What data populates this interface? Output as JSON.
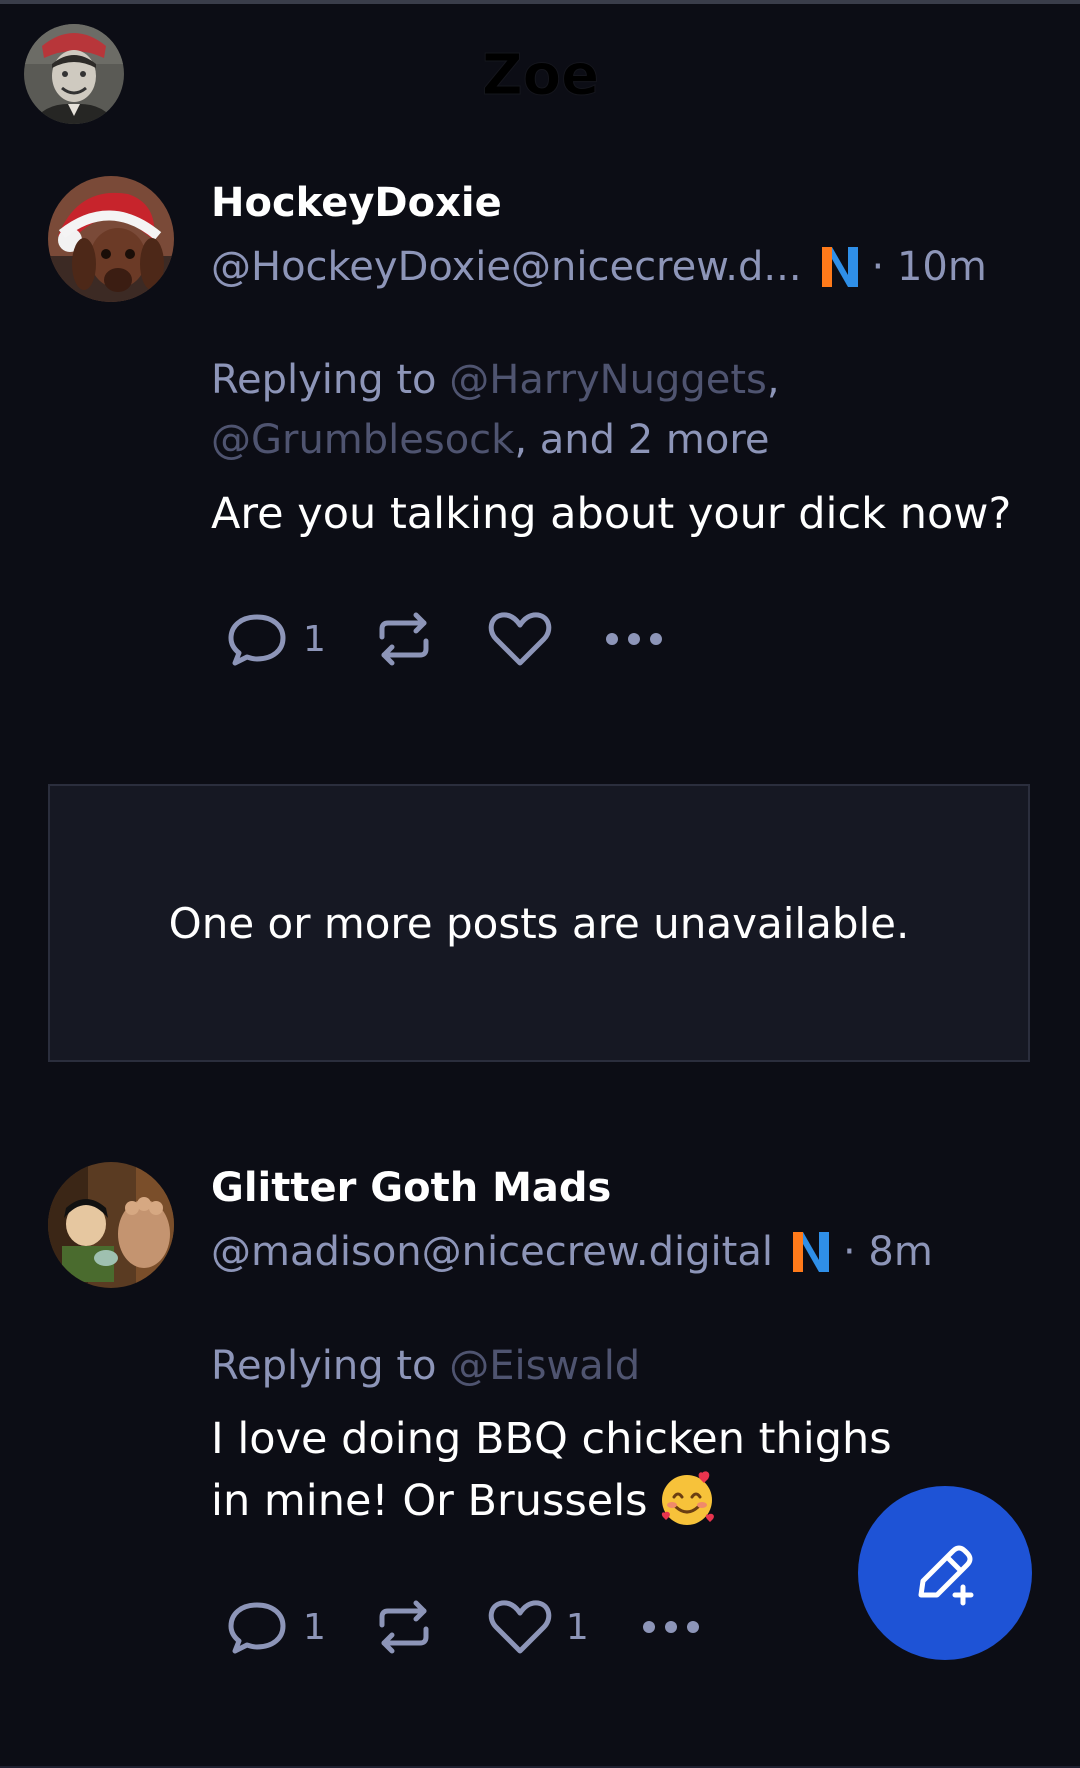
{
  "app": {
    "logo_text": "Zoe"
  },
  "colors": {
    "background": "#0c0d15",
    "muted_text": "#8d95b8",
    "mention_text": "#4f5470",
    "fab": "#1e53d6"
  },
  "posts": [
    {
      "display_name": "HockeyDoxie",
      "handle": "@HockeyDoxie@nicecrew.d...",
      "time": "· 10m",
      "reply_prefix": "Replying to ",
      "mention_1": "@HarryNuggets",
      "sep_1": ",",
      "mention_2": "@Grumblesock",
      "reply_suffix": ", and 2 more",
      "content": "Are you talking about your dick now?",
      "reply_count": "1",
      "repost_count": "",
      "like_count": ""
    },
    {
      "display_name": "Glitter Goth Mads",
      "handle": "@madison@nicecrew.digital",
      "time": "· 8m",
      "reply_prefix": "Replying to ",
      "mention_1": "@Eiswald",
      "content": "I love doing BBQ chicken thighs in mine! Or Brussels",
      "reply_count": "1",
      "repost_count": "",
      "like_count": "1"
    }
  ],
  "unavailable": {
    "text": "One or more posts are unavailable."
  },
  "icons": {
    "header_avatar": "user-avatar-icon",
    "server": "nicecrew-server-icon",
    "reply": "reply-bubble-icon",
    "repost": "repost-icon",
    "like": "heart-icon",
    "more": "more-dots-icon",
    "compose": "compose-pencil-icon",
    "emoji": "smiling-face-with-hearts-emoji"
  }
}
